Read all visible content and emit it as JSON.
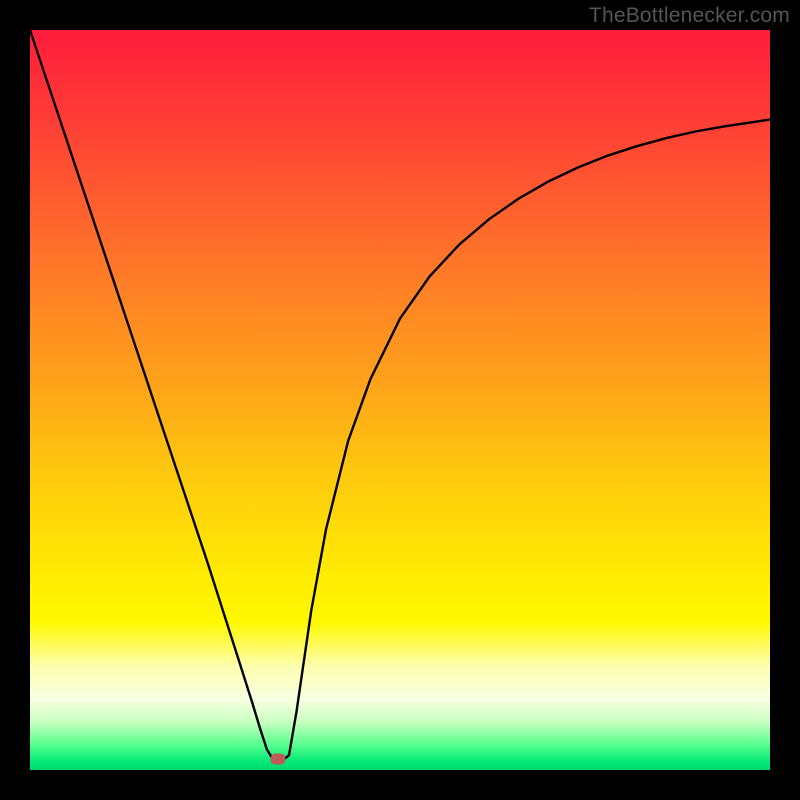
{
  "source_label": "TheBottlenecker.com",
  "gradient_stops": [
    {
      "offset": 0.0,
      "color": "#ff1c3c"
    },
    {
      "offset": 0.1,
      "color": "#ff3737"
    },
    {
      "offset": 0.22,
      "color": "#ff5a30"
    },
    {
      "offset": 0.35,
      "color": "#ff8026"
    },
    {
      "offset": 0.48,
      "color": "#ffa31a"
    },
    {
      "offset": 0.6,
      "color": "#ffc90e"
    },
    {
      "offset": 0.72,
      "color": "#ffe704"
    },
    {
      "offset": 0.8,
      "color": "#fff800"
    },
    {
      "offset": 0.86,
      "color": "#fdffb0"
    },
    {
      "offset": 0.905,
      "color": "#f8ffe2"
    },
    {
      "offset": 0.935,
      "color": "#c8ffc0"
    },
    {
      "offset": 0.965,
      "color": "#5aff90"
    },
    {
      "offset": 0.99,
      "color": "#00e876"
    },
    {
      "offset": 1.0,
      "color": "#00d870"
    }
  ],
  "marker": {
    "x_frac": 0.3345,
    "y_frac": 0.985
  },
  "chart_data": {
    "type": "line",
    "title": "",
    "xlabel": "",
    "ylabel": "",
    "xlim": [
      0,
      1
    ],
    "ylim": [
      0,
      1
    ],
    "series": [
      {
        "name": "bottleneck-curve",
        "x": [
          0.0,
          0.04,
          0.08,
          0.12,
          0.16,
          0.2,
          0.24,
          0.28,
          0.3,
          0.31,
          0.32,
          0.33,
          0.34,
          0.35,
          0.36,
          0.38,
          0.4,
          0.43,
          0.46,
          0.5,
          0.54,
          0.58,
          0.62,
          0.66,
          0.7,
          0.74,
          0.78,
          0.82,
          0.86,
          0.9,
          0.94,
          0.98,
          1.0
        ],
        "y": [
          1.0,
          0.88,
          0.76,
          0.64,
          0.52,
          0.4,
          0.28,
          0.155,
          0.092,
          0.059,
          0.028,
          0.012,
          0.012,
          0.02,
          0.078,
          0.215,
          0.325,
          0.445,
          0.528,
          0.61,
          0.667,
          0.71,
          0.744,
          0.772,
          0.795,
          0.814,
          0.83,
          0.843,
          0.854,
          0.863,
          0.87,
          0.876,
          0.879
        ]
      }
    ],
    "annotations": [
      {
        "text": "TheBottlenecker.com",
        "position": "top-right"
      }
    ],
    "optimum_point": {
      "x": 0.3345,
      "y": 0.015
    }
  }
}
